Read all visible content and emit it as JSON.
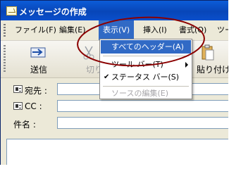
{
  "window": {
    "title": "メッセージの作成"
  },
  "menubar": {
    "items": [
      "ファイル(F)",
      "編集(E)",
      "表示(V)",
      "挿入(I)",
      "書式(O)",
      "ツー"
    ],
    "active_index": 2
  },
  "toolbar": {
    "send_label": "送信",
    "cut_label": "切り",
    "paste_label": "貼り付け"
  },
  "fields": {
    "to_label": "宛先 :",
    "cc_label": "CC :",
    "subject_label": "件名 :",
    "to_value": "",
    "cc_value": "",
    "subject_value": ""
  },
  "view_menu": {
    "all_headers": "すべてのヘッダー(A)",
    "toolbars": "ツール バー(T)",
    "status_bar": "ステータス バー(S)",
    "source_edit": "ソースの編集(E)"
  },
  "colors": {
    "highlight": "#316ac5",
    "annotation_oval": "#8b0000",
    "titlebar": "#0a4fcc"
  }
}
